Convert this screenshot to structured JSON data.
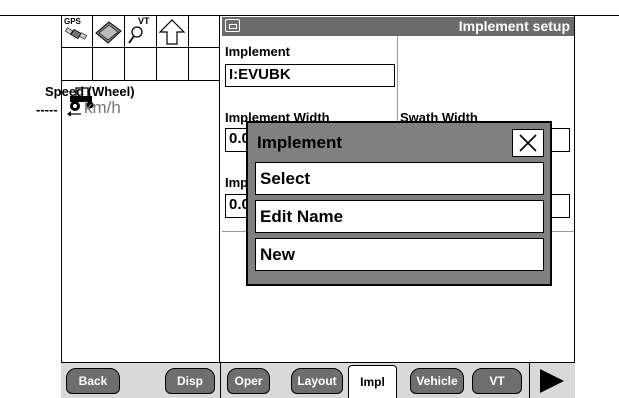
{
  "status_panel": {
    "icons": [
      "gps-icon",
      "implement-icon",
      "vt-icon",
      "up-arrow-icon"
    ],
    "gps_label": "GPS",
    "vt_label": "VT",
    "speed_label": "Speed (Wheel)",
    "speed_value": "-----",
    "speed_unit": "km/h"
  },
  "screen": {
    "title": "Implement setup",
    "implement_label": "Implement",
    "implement_value": "I:EVUBK",
    "implement_width_label": "Implement Width",
    "implement_width_value": "0.0",
    "swath_width_label": "Swath Width",
    "imp_label_partial": "Imp",
    "imp_value_partial": "0.0"
  },
  "modal": {
    "title": "Implement",
    "items": [
      "Select",
      "Edit Name",
      "New"
    ]
  },
  "tabs": {
    "back": "Back",
    "disp": "Disp",
    "oper": "Oper",
    "layout": "Layout",
    "impl": "Impl",
    "vehicle": "Vehicle",
    "vt": "VT",
    "active": "Impl"
  },
  "colors": {
    "title_bar": "#6b6b6b",
    "modal_bg": "#808080",
    "tab_bg": "#6e6e6e",
    "tabbar_bg": "#d9d9d9"
  }
}
